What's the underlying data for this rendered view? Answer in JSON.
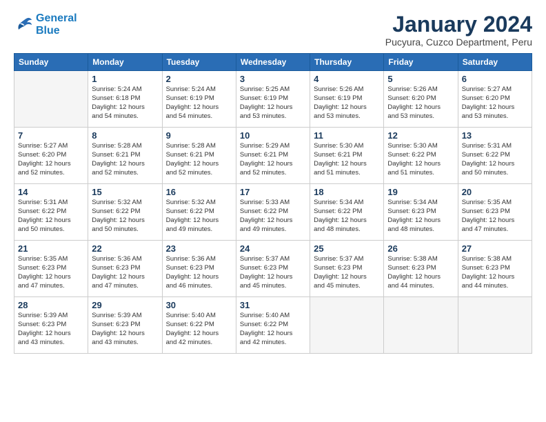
{
  "logo": {
    "line1": "General",
    "line2": "Blue"
  },
  "title": "January 2024",
  "location": "Pucyura, Cuzco Department, Peru",
  "headers": [
    "Sunday",
    "Monday",
    "Tuesday",
    "Wednesday",
    "Thursday",
    "Friday",
    "Saturday"
  ],
  "weeks": [
    [
      {
        "num": "",
        "info": ""
      },
      {
        "num": "1",
        "info": "Sunrise: 5:24 AM\nSunset: 6:18 PM\nDaylight: 12 hours\nand 54 minutes."
      },
      {
        "num": "2",
        "info": "Sunrise: 5:24 AM\nSunset: 6:19 PM\nDaylight: 12 hours\nand 54 minutes."
      },
      {
        "num": "3",
        "info": "Sunrise: 5:25 AM\nSunset: 6:19 PM\nDaylight: 12 hours\nand 53 minutes."
      },
      {
        "num": "4",
        "info": "Sunrise: 5:26 AM\nSunset: 6:19 PM\nDaylight: 12 hours\nand 53 minutes."
      },
      {
        "num": "5",
        "info": "Sunrise: 5:26 AM\nSunset: 6:20 PM\nDaylight: 12 hours\nand 53 minutes."
      },
      {
        "num": "6",
        "info": "Sunrise: 5:27 AM\nSunset: 6:20 PM\nDaylight: 12 hours\nand 53 minutes."
      }
    ],
    [
      {
        "num": "7",
        "info": "Sunrise: 5:27 AM\nSunset: 6:20 PM\nDaylight: 12 hours\nand 52 minutes."
      },
      {
        "num": "8",
        "info": "Sunrise: 5:28 AM\nSunset: 6:21 PM\nDaylight: 12 hours\nand 52 minutes."
      },
      {
        "num": "9",
        "info": "Sunrise: 5:28 AM\nSunset: 6:21 PM\nDaylight: 12 hours\nand 52 minutes."
      },
      {
        "num": "10",
        "info": "Sunrise: 5:29 AM\nSunset: 6:21 PM\nDaylight: 12 hours\nand 52 minutes."
      },
      {
        "num": "11",
        "info": "Sunrise: 5:30 AM\nSunset: 6:21 PM\nDaylight: 12 hours\nand 51 minutes."
      },
      {
        "num": "12",
        "info": "Sunrise: 5:30 AM\nSunset: 6:22 PM\nDaylight: 12 hours\nand 51 minutes."
      },
      {
        "num": "13",
        "info": "Sunrise: 5:31 AM\nSunset: 6:22 PM\nDaylight: 12 hours\nand 50 minutes."
      }
    ],
    [
      {
        "num": "14",
        "info": "Sunrise: 5:31 AM\nSunset: 6:22 PM\nDaylight: 12 hours\nand 50 minutes."
      },
      {
        "num": "15",
        "info": "Sunrise: 5:32 AM\nSunset: 6:22 PM\nDaylight: 12 hours\nand 50 minutes."
      },
      {
        "num": "16",
        "info": "Sunrise: 5:32 AM\nSunset: 6:22 PM\nDaylight: 12 hours\nand 49 minutes."
      },
      {
        "num": "17",
        "info": "Sunrise: 5:33 AM\nSunset: 6:22 PM\nDaylight: 12 hours\nand 49 minutes."
      },
      {
        "num": "18",
        "info": "Sunrise: 5:34 AM\nSunset: 6:22 PM\nDaylight: 12 hours\nand 48 minutes."
      },
      {
        "num": "19",
        "info": "Sunrise: 5:34 AM\nSunset: 6:23 PM\nDaylight: 12 hours\nand 48 minutes."
      },
      {
        "num": "20",
        "info": "Sunrise: 5:35 AM\nSunset: 6:23 PM\nDaylight: 12 hours\nand 47 minutes."
      }
    ],
    [
      {
        "num": "21",
        "info": "Sunrise: 5:35 AM\nSunset: 6:23 PM\nDaylight: 12 hours\nand 47 minutes."
      },
      {
        "num": "22",
        "info": "Sunrise: 5:36 AM\nSunset: 6:23 PM\nDaylight: 12 hours\nand 47 minutes."
      },
      {
        "num": "23",
        "info": "Sunrise: 5:36 AM\nSunset: 6:23 PM\nDaylight: 12 hours\nand 46 minutes."
      },
      {
        "num": "24",
        "info": "Sunrise: 5:37 AM\nSunset: 6:23 PM\nDaylight: 12 hours\nand 45 minutes."
      },
      {
        "num": "25",
        "info": "Sunrise: 5:37 AM\nSunset: 6:23 PM\nDaylight: 12 hours\nand 45 minutes."
      },
      {
        "num": "26",
        "info": "Sunrise: 5:38 AM\nSunset: 6:23 PM\nDaylight: 12 hours\nand 44 minutes."
      },
      {
        "num": "27",
        "info": "Sunrise: 5:38 AM\nSunset: 6:23 PM\nDaylight: 12 hours\nand 44 minutes."
      }
    ],
    [
      {
        "num": "28",
        "info": "Sunrise: 5:39 AM\nSunset: 6:23 PM\nDaylight: 12 hours\nand 43 minutes."
      },
      {
        "num": "29",
        "info": "Sunrise: 5:39 AM\nSunset: 6:23 PM\nDaylight: 12 hours\nand 43 minutes."
      },
      {
        "num": "30",
        "info": "Sunrise: 5:40 AM\nSunset: 6:22 PM\nDaylight: 12 hours\nand 42 minutes."
      },
      {
        "num": "31",
        "info": "Sunrise: 5:40 AM\nSunset: 6:22 PM\nDaylight: 12 hours\nand 42 minutes."
      },
      {
        "num": "",
        "info": ""
      },
      {
        "num": "",
        "info": ""
      },
      {
        "num": "",
        "info": ""
      }
    ]
  ]
}
